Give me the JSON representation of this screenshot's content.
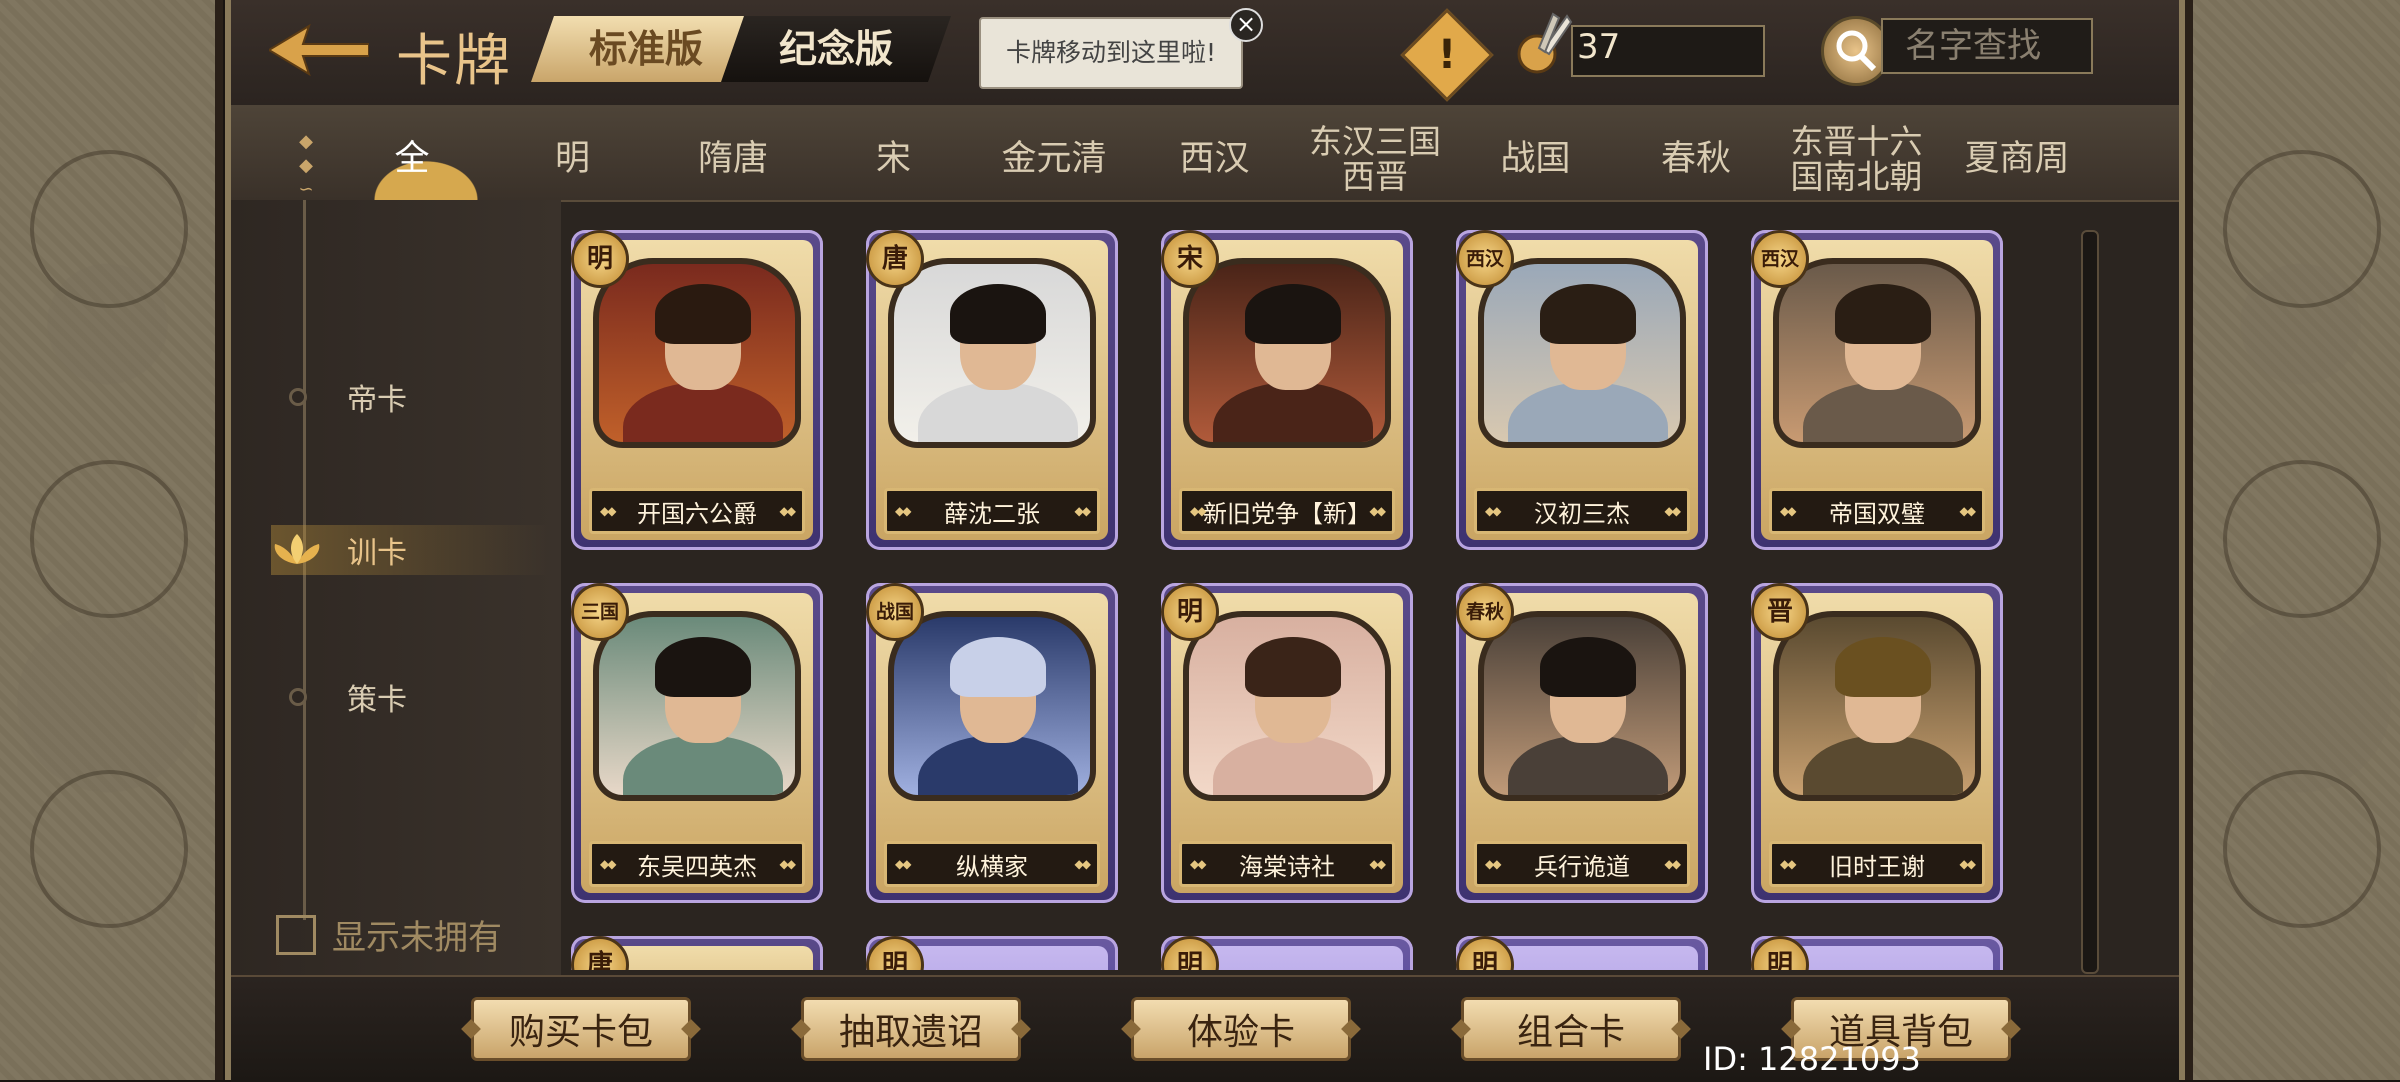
{
  "header": {
    "title": "卡牌",
    "tab_standard": "标准版",
    "tab_memorial": "纪念版",
    "tooltip": "卡牌移动到这里啦!",
    "tooltip_close": "×",
    "warning_icon_text": "!",
    "coin_count": "37",
    "search_placeholder": "名字查找"
  },
  "era_tabs": [
    {
      "label": "全",
      "active": true
    },
    {
      "label": "明"
    },
    {
      "label": "隋唐"
    },
    {
      "label": "宋"
    },
    {
      "label": "金元清"
    },
    {
      "label": "西汉"
    },
    {
      "label": "东汉三国\n西晋"
    },
    {
      "label": "战国"
    },
    {
      "label": "春秋"
    },
    {
      "label": "东晋十六\n国南北朝"
    },
    {
      "label": "夏商周"
    }
  ],
  "categories": [
    {
      "label": "帝卡"
    },
    {
      "label": "训卡",
      "active": true
    },
    {
      "label": "策卡"
    }
  ],
  "show_unowned_label": "显示未拥有",
  "cards": [
    {
      "era": "明",
      "name": "开国六公爵"
    },
    {
      "era": "唐",
      "name": "薛沈二张"
    },
    {
      "era": "宋",
      "name": "新旧党争【新】"
    },
    {
      "era": "西汉",
      "name": "汉初三杰"
    },
    {
      "era": "西汉",
      "name": "帝国双璧"
    },
    {
      "era": "三国",
      "name": "东吴四英杰"
    },
    {
      "era": "战国",
      "name": "纵横家"
    },
    {
      "era": "明",
      "name": "海棠诗社"
    },
    {
      "era": "春秋",
      "name": "兵行诡道"
    },
    {
      "era": "晋",
      "name": "旧时王谢"
    },
    {
      "era": "唐",
      "name": ""
    },
    {
      "era": "明",
      "name": ""
    },
    {
      "era": "明",
      "name": ""
    },
    {
      "era": "明",
      "name": ""
    },
    {
      "era": "明",
      "name": ""
    }
  ],
  "bottom_buttons": [
    {
      "label": "购买卡包"
    },
    {
      "label": "抽取遗诏"
    },
    {
      "label": "体验卡"
    },
    {
      "label": "组合卡"
    },
    {
      "label": "道具背包"
    }
  ],
  "player_id": "ID: 12821093",
  "colors": {
    "accent_gold": "#e9c48a",
    "card_purple": "#5a4a8a",
    "badge_gold": "#f6d68a"
  }
}
